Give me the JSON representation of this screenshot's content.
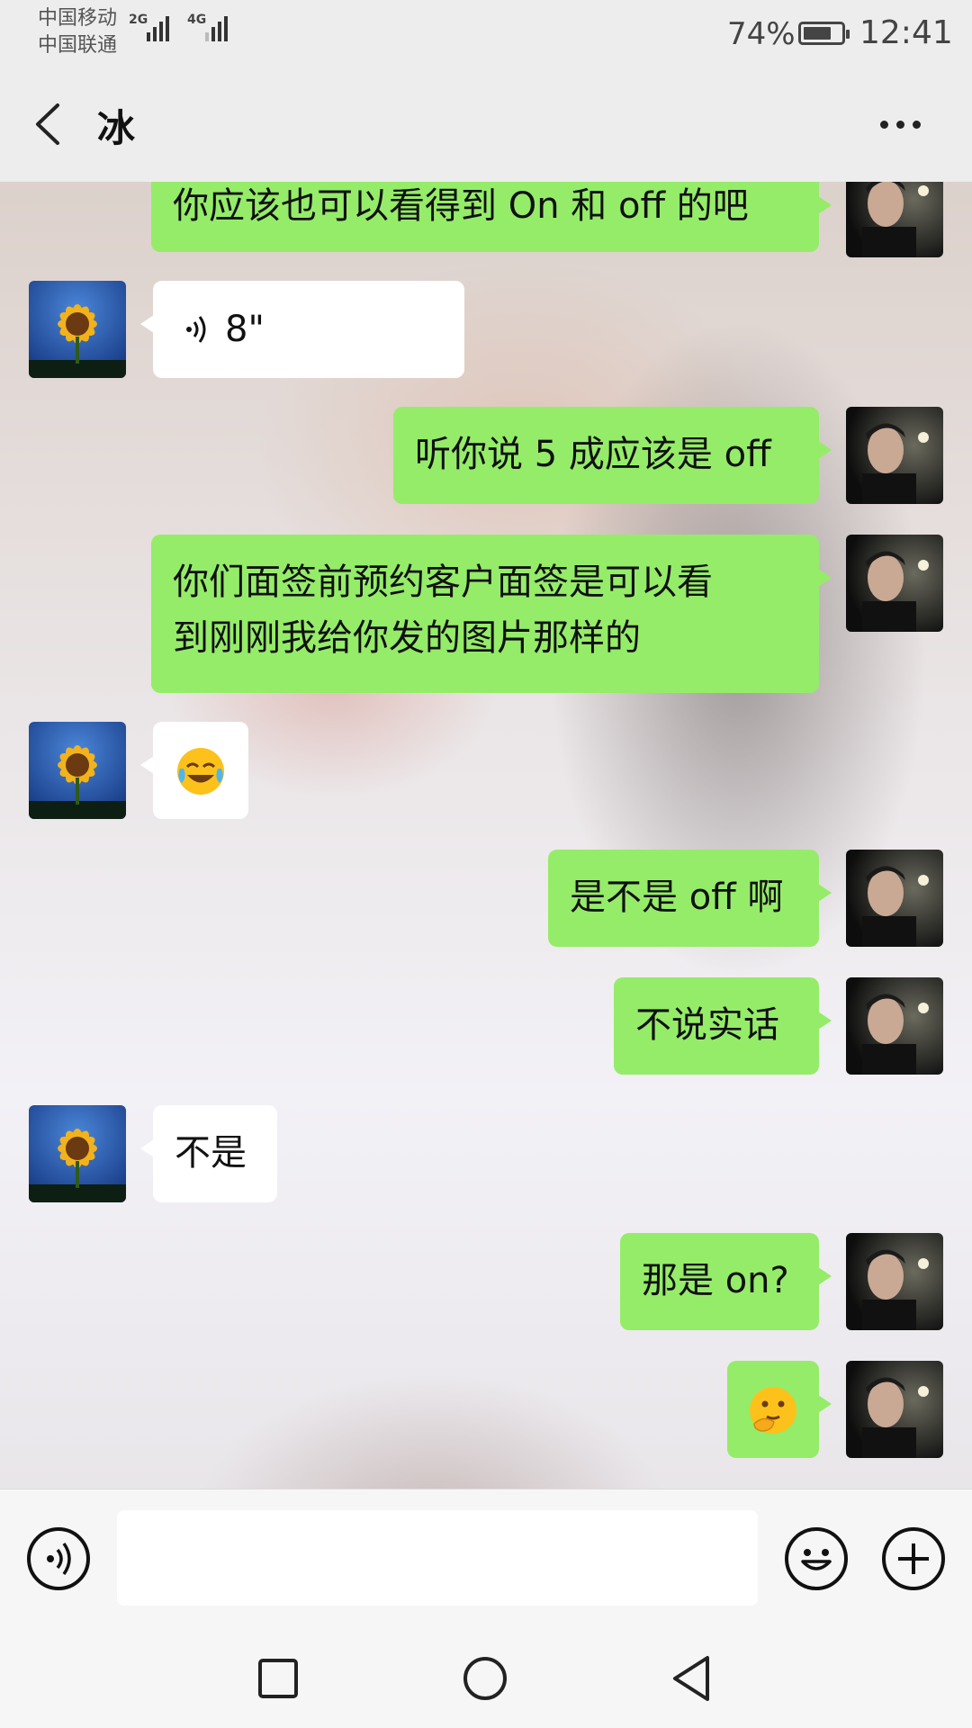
{
  "status_bar": {
    "carrier_1": "中国移动",
    "carrier_2": "中国联通",
    "network_1": "2G",
    "network_2": "4G",
    "battery_percent": "74%",
    "battery_level": 0.74,
    "time": "12:41"
  },
  "header": {
    "title": "冰",
    "back_icon": "chevron-left-icon",
    "more_icon": "more-dots-icon"
  },
  "messages": [
    {
      "side": "right",
      "type": "text",
      "text": "你应该也可以看得到 On 和 off 的吧"
    },
    {
      "side": "left",
      "type": "voice",
      "duration": "8\""
    },
    {
      "side": "right",
      "type": "text",
      "text": "听你说 5 成应该是 off"
    },
    {
      "side": "right",
      "type": "text",
      "line1": "你们面签前预约客户面签是可以看",
      "line2": "到刚刚我给你发的图片那样的"
    },
    {
      "side": "left",
      "type": "emoji",
      "emoji": "crying-laughing-emoji"
    },
    {
      "side": "right",
      "type": "text",
      "text": "是不是 off 啊"
    },
    {
      "side": "right",
      "type": "text",
      "text": "不说实话"
    },
    {
      "side": "left",
      "type": "text",
      "text": "不是"
    },
    {
      "side": "right",
      "type": "text",
      "text": "那是 on?"
    },
    {
      "side": "right",
      "type": "emoji",
      "emoji": "thinking-emoji"
    }
  ],
  "input_bar": {
    "voice_icon": "voice-input-icon",
    "input_value": "",
    "emoji_icon": "smiley-icon",
    "plus_icon": "plus-icon"
  },
  "system_nav": {
    "recent_icon": "square-icon",
    "home_icon": "circle-icon",
    "back_icon": "triangle-back-icon"
  },
  "colors": {
    "sent_bubble": "#95ec69",
    "received_bubble": "#ffffff",
    "header_bg": "#ededed"
  }
}
